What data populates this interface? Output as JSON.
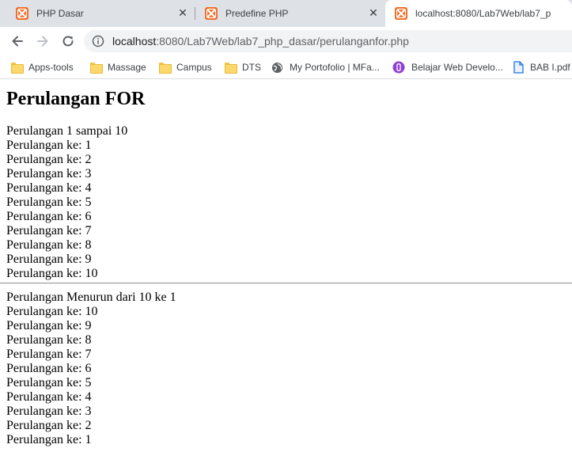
{
  "browser": {
    "tabs": [
      {
        "title": "PHP Dasar",
        "close": "✕",
        "active": false
      },
      {
        "title": "Predefine PHP",
        "close": "✕",
        "active": false
      },
      {
        "title": "localhost:8080/Lab7Web/lab7_ph",
        "close": "✕",
        "active": true
      }
    ],
    "url_host": "localhost",
    "url_rest": ":8080/Lab7Web/lab7_php_dasar/perulanganfor.php",
    "bookmarks": [
      {
        "label": "Apps-tools",
        "icon": "folder-icon"
      },
      {
        "label": "Massage",
        "icon": "folder-icon"
      },
      {
        "label": "Campus",
        "icon": "folder-icon"
      },
      {
        "label": "DTS",
        "icon": "folder-icon"
      },
      {
        "label": "My Portofolio | MFa...",
        "icon": "globe-icon"
      },
      {
        "label": "Belajar Web Develo...",
        "icon": "purple-logo-icon"
      },
      {
        "label": "BAB I.pdf",
        "icon": "file-icon"
      }
    ]
  },
  "page": {
    "heading": "Perulangan FOR",
    "section1": {
      "title": "Perulangan 1 sampai 10",
      "lines": [
        "Perulangan ke: 1",
        "Perulangan ke: 2",
        "Perulangan ke: 3",
        "Perulangan ke: 4",
        "Perulangan ke: 5",
        "Perulangan ke: 6",
        "Perulangan ke: 7",
        "Perulangan ke: 8",
        "Perulangan ke: 9",
        "Perulangan ke: 10"
      ]
    },
    "section2": {
      "title": "Perulangan Menurun dari 10 ke 1",
      "lines": [
        "Perulangan ke: 10",
        "Perulangan ke: 9",
        "Perulangan ke: 8",
        "Perulangan ke: 7",
        "Perulangan ke: 6",
        "Perulangan ke: 5",
        "Perulangan ke: 4",
        "Perulangan ke: 3",
        "Perulangan ke: 2",
        "Perulangan ke: 1"
      ]
    }
  },
  "colors": {
    "tabstrip": "#dee1e6",
    "favicon": "#f26a22",
    "omnibox": "#f1f3f4"
  }
}
